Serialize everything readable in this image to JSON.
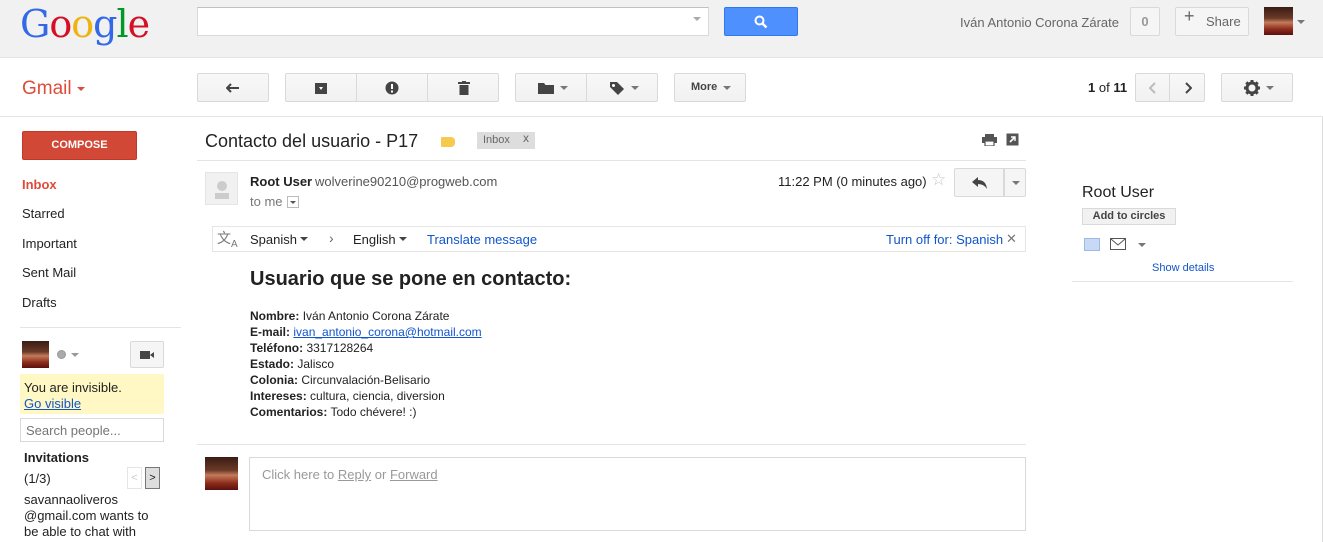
{
  "header": {
    "logo_text": "Google",
    "search": {
      "value": "",
      "placeholder": ""
    },
    "user_name": "Iván Antonio Corona Zárate",
    "notifications_count": "0",
    "share_label": "Share"
  },
  "toolbar": {
    "app_label": "Gmail",
    "more_label": "More",
    "pager": {
      "current": "1",
      "separator": "of",
      "total": "11"
    }
  },
  "sidebar": {
    "compose_label": "COMPOSE",
    "items": [
      {
        "label": "Inbox",
        "active": true
      },
      {
        "label": "Starred"
      },
      {
        "label": "Important"
      },
      {
        "label": "Sent Mail"
      },
      {
        "label": "Drafts"
      }
    ],
    "chat": {
      "invisible_text": "You are invisible.",
      "go_visible": "Go visible",
      "search_placeholder": "Search people...",
      "invitations_title": "Invitations",
      "invitations_count": "(1/3)",
      "invitation_message": "savannaoliveros @gmail.com wants to be able to chat with"
    }
  },
  "message": {
    "subject": "Contacto del usuario - P17",
    "label": "Inbox",
    "label_remove": "x",
    "sender_name": "Root User",
    "sender_email": "wolverine90210@progweb.com",
    "to": "to me",
    "timestamp": "11:22 PM (0 minutes ago)",
    "translate": {
      "from_lang": "Spanish",
      "to_lang": "English",
      "translate_link": "Translate message",
      "turn_off": "Turn off for: Spanish"
    },
    "body": {
      "title": "Usuario que se pone en contacto:",
      "fields": [
        {
          "label": "Nombre:",
          "value": "Iván Antonio Corona Zárate"
        },
        {
          "label": "E-mail:",
          "value": "ivan_antonio_corona@hotmail.com"
        },
        {
          "label": "Teléfono:",
          "value": "3317128264"
        },
        {
          "label": "Estado:",
          "value": "Jalisco"
        },
        {
          "label": "Colonia:",
          "value": "Circunvalación-Belisario"
        },
        {
          "label": "Intereses:",
          "value": "cultura, ciencia, diversion"
        },
        {
          "label": "Comentarios:",
          "value": "Todo chévere! :)"
        }
      ]
    },
    "reply_prompt": {
      "prefix": "Click here to",
      "reply": "Reply",
      "or": "or",
      "forward": "Forward"
    }
  },
  "contact_panel": {
    "name": "Root User",
    "add_to_circles": "Add to circles",
    "show_details": "Show details"
  },
  "colors": {
    "accent_red": "#dd4b39",
    "search_blue": "#4d90fe",
    "link_blue": "#1155cc"
  }
}
